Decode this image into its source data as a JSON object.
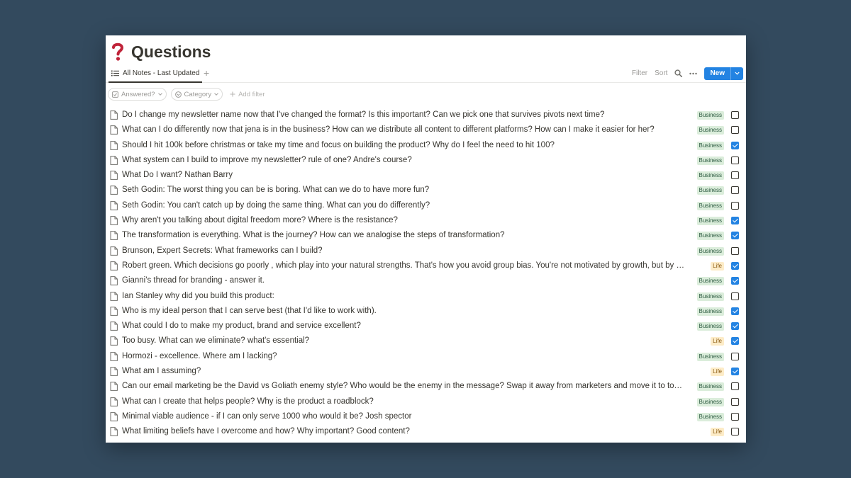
{
  "page": {
    "icon": "question-mark-icon",
    "title": "Questions"
  },
  "toolbar": {
    "view_label": "All Notes - Last Updated",
    "add_view": "+",
    "filter_label": "Filter",
    "sort_label": "Sort",
    "search_icon": "search-icon",
    "more_icon": "more-icon",
    "new_label": "New",
    "new_caret": "⌄"
  },
  "filters": {
    "chips": [
      {
        "label": "Answered?",
        "icon": "checkbox-icon"
      },
      {
        "label": "Category",
        "icon": "select-icon"
      }
    ],
    "add_filter": "Add filter"
  },
  "colors": {
    "accent": "#2383e2",
    "business_tag_bg": "#dbeddb",
    "life_tag_bg": "#fdecc8",
    "backdrop": "#334a5e",
    "title_icon": "#c0243a"
  },
  "rows": [
    {
      "title": "Do I change my newsletter name now that I've changed the format? Is this important? Can we pick one that survives pivots next time?",
      "tag": "Business",
      "checked": false
    },
    {
      "title": "What can I do differently now that jena is in the business? How can we distribute all content to different platforms? How can I make it easier for her?",
      "tag": "Business",
      "checked": false
    },
    {
      "title": "Should I hit 100k before christmas or take my time and focus on building the product? Why do I feel the need to hit 100?",
      "tag": "Business",
      "checked": true
    },
    {
      "title": "What system can I build to improve my newsletter? rule of one? Andre's course?",
      "tag": "Business",
      "checked": false
    },
    {
      "title": "What Do I want? Nathan Barry",
      "tag": "Business",
      "checked": false
    },
    {
      "title": "Seth Godin: The worst thing you can be is boring. What can we do to have more fun?",
      "tag": "Business",
      "checked": false
    },
    {
      "title": "Seth Godin: You can't catch up by doing the same thing. What can you do differently?",
      "tag": "Business",
      "checked": false
    },
    {
      "title": "Why aren't you talking about digital freedom more? Where is the resistance?",
      "tag": "Business",
      "checked": true
    },
    {
      "title": "The transformation is everything. What is the journey? How can we analogise the steps of transformation?",
      "tag": "Business",
      "checked": true
    },
    {
      "title": "Brunson, Expert Secrets: What frameworks can I build?",
      "tag": "Business",
      "checked": false
    },
    {
      "title": "Robert green. Which decisions go poorly , which play into your natural strengths. That's how you avoid group bias. You're not motivated by growth, but by writing",
      "tag": "Life",
      "checked": true
    },
    {
      "title": "Gianni's thread for branding - answer it.",
      "tag": "Business",
      "checked": true
    },
    {
      "title": "Ian Stanley why did you build this product:",
      "tag": "Business",
      "checked": false
    },
    {
      "title": "Who is my ideal person that I can serve best (that I'd like to work with).",
      "tag": "Business",
      "checked": true
    },
    {
      "title": "What could I do to make my product, brand and service excellent?",
      "tag": "Business",
      "checked": true
    },
    {
      "title": "Too busy. What can we eliminate? what's essential?",
      "tag": "Life",
      "checked": true
    },
    {
      "title": "Hormozi - excellence. Where am I lacking?",
      "tag": "Business",
      "checked": false
    },
    {
      "title": "What am I assuming?",
      "tag": "Life",
      "checked": true
    },
    {
      "title": "Can our email marketing be the David vs Goliath enemy style? Who would be the enemy in the message? Swap it away from marketers and move it to toxic soc",
      "tag": "Business",
      "checked": false
    },
    {
      "title": "What can I create that helps people? Why is the product a roadblock?",
      "tag": "Business",
      "checked": false
    },
    {
      "title": "Minimal viable audience - if I can only serve 1000 who would it be? Josh spector",
      "tag": "Business",
      "checked": false
    },
    {
      "title": "What limiting beliefs have I overcome and how? Why important? Good content?",
      "tag": "Life",
      "checked": false
    }
  ]
}
